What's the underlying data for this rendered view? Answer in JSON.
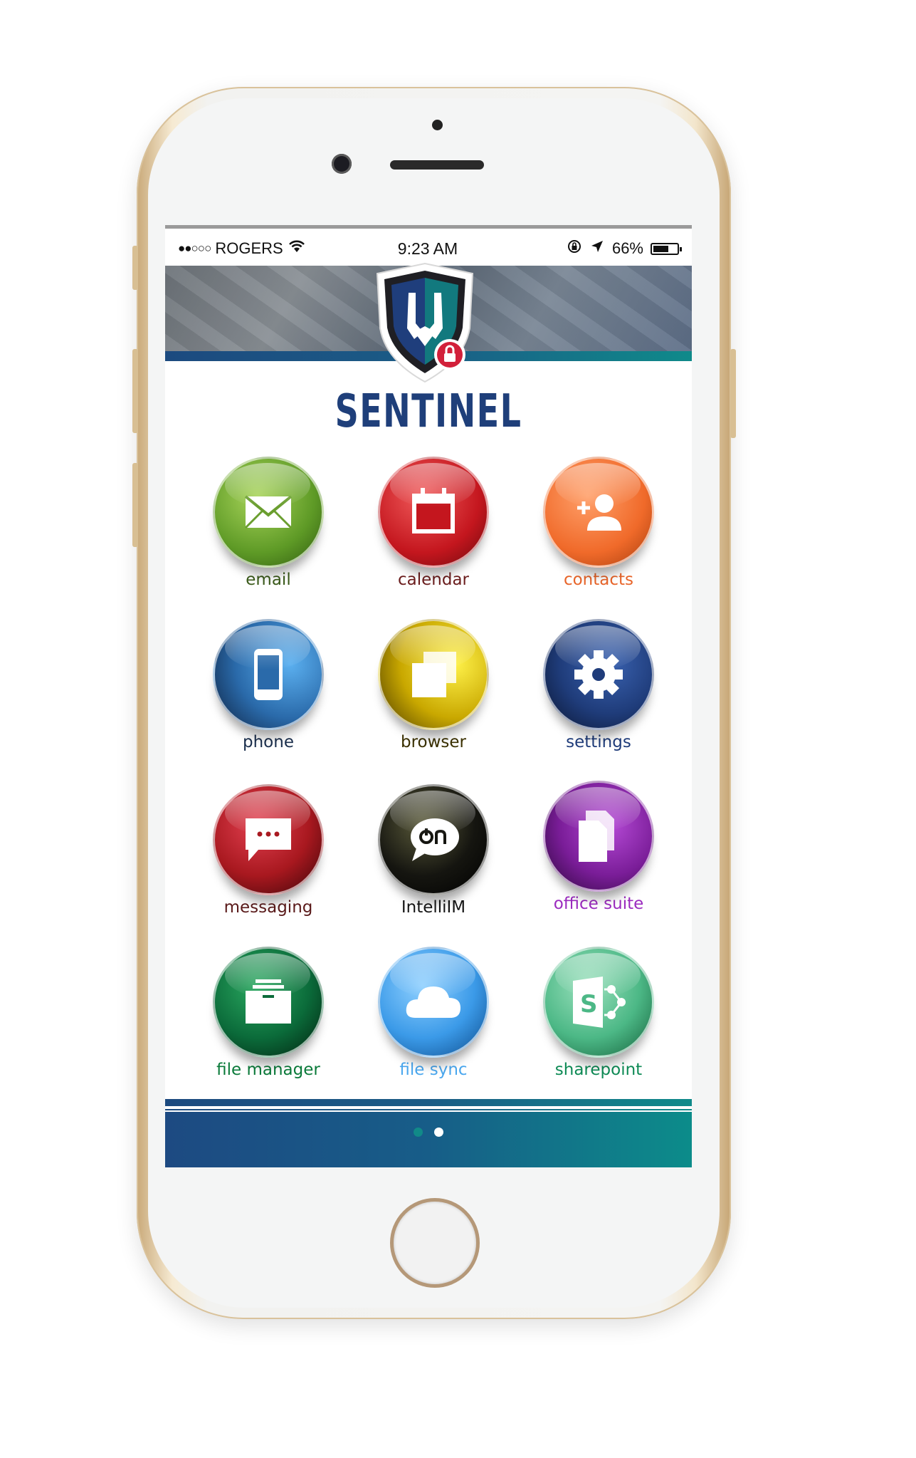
{
  "status_bar": {
    "signal": "●●○○○",
    "carrier": "ROGERS",
    "time": "9:23 AM",
    "battery_percent": "66%",
    "battery_level": 0.66
  },
  "app": {
    "brand": "SENTINEL"
  },
  "apps": [
    {
      "label": "email",
      "icon": "envelope-icon",
      "color": "#7cb342",
      "label_color": "#3a5a1a"
    },
    {
      "label": "calendar",
      "icon": "calendar-icon",
      "color": "#d32f2f",
      "label_color": "#6b1d1d"
    },
    {
      "label": "contacts",
      "icon": "add-contact-icon",
      "color": "#f57c3a",
      "label_color": "#e8652a"
    },
    {
      "label": "phone",
      "icon": "smartphone-icon",
      "color": "#3b8fd6",
      "label_color": "#1b2f4d"
    },
    {
      "label": "browser",
      "icon": "windows-icon",
      "color": "#d4b400",
      "label_color": "#3a3000"
    },
    {
      "label": "settings",
      "icon": "gear-icon",
      "color": "#1f3c7a",
      "label_color": "#1f3c7a"
    },
    {
      "label": "messaging",
      "icon": "chat-bubble-icon",
      "color": "#b0202c",
      "label_color": "#5a1a1a"
    },
    {
      "label": "IntelliIM",
      "icon": "on-chat-icon",
      "color": "#151510",
      "label_color": "#151515"
    },
    {
      "label": "office suite",
      "icon": "documents-icon",
      "color": "#8e24aa",
      "label_color": "#9b2bbf"
    },
    {
      "label": "file manager",
      "icon": "folder-icon",
      "color": "#0b6b3a",
      "label_color": "#0b7a3a"
    },
    {
      "label": "file sync",
      "icon": "cloud-icon",
      "color": "#4aa7ee",
      "label_color": "#4aa7ee"
    },
    {
      "label": "sharepoint",
      "icon": "sharepoint-icon",
      "color": "#4cb886",
      "label_color": "#0e8a55"
    }
  ],
  "pager": {
    "pages": 2,
    "current": 2
  }
}
